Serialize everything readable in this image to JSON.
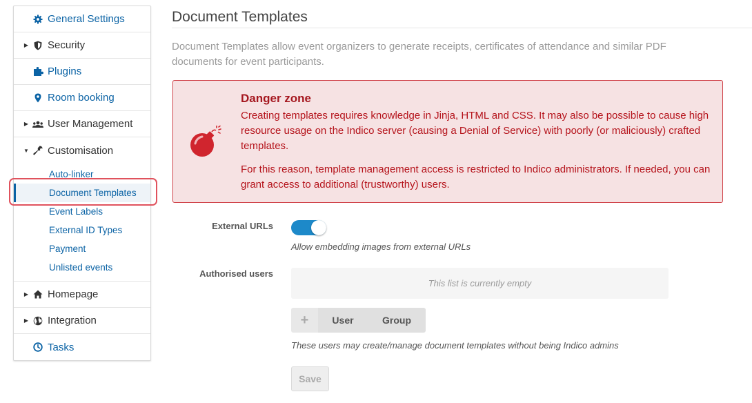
{
  "sidebar": {
    "items": [
      {
        "label": "General Settings",
        "icon": "gear-icon"
      },
      {
        "label": "Security",
        "icon": "shield-icon"
      },
      {
        "label": "Plugins",
        "icon": "puzzle-icon"
      },
      {
        "label": "Room booking",
        "icon": "map-pin-icon"
      },
      {
        "label": "User Management",
        "icon": "users-icon"
      },
      {
        "label": "Customisation",
        "icon": "wrench-icon"
      },
      {
        "label": "Homepage",
        "icon": "home-icon"
      },
      {
        "label": "Integration",
        "icon": "globe-icon"
      },
      {
        "label": "Tasks",
        "icon": "clock-icon"
      }
    ],
    "customisation_submenu": [
      {
        "label": "Auto-linker"
      },
      {
        "label": "Document Templates"
      },
      {
        "label": "Event Labels"
      },
      {
        "label": "External ID Types"
      },
      {
        "label": "Payment"
      },
      {
        "label": "Unlisted events"
      }
    ],
    "active_item": "Document Templates"
  },
  "main": {
    "title": "Document Templates",
    "description": "Document Templates allow event organizers to generate receipts, certificates of attendance and similar PDF documents for event participants.",
    "danger": {
      "title": "Danger zone",
      "paragraph1": "Creating templates requires knowledge in Jinja, HTML and CSS. It may also be possible to cause high resource usage on the Indico server (causing a Denial of Service) with poorly (or maliciously) crafted templates.",
      "paragraph2": "For this reason, template management access is restricted to Indico administrators. If needed, you can grant access to additional (trustworthy) users.",
      "icon": "bomb-icon"
    },
    "external_urls": {
      "label": "External URLs",
      "enabled": true,
      "help": "Allow embedding images from external URLs"
    },
    "authorised_users": {
      "label": "Authorised users",
      "empty_text": "This list is currently empty",
      "add_icon": "+",
      "user_button": "User",
      "group_button": "Group",
      "help": "These users may create/manage document templates without being Indico admins"
    },
    "save_label": "Save"
  },
  "colors": {
    "link": "#0b63a5",
    "danger_bg": "#f6e2e3",
    "danger_border": "#cf3e45",
    "danger_text": "#b5131b",
    "toggle_on": "#1d89c9",
    "highlight": "#e0525d"
  }
}
